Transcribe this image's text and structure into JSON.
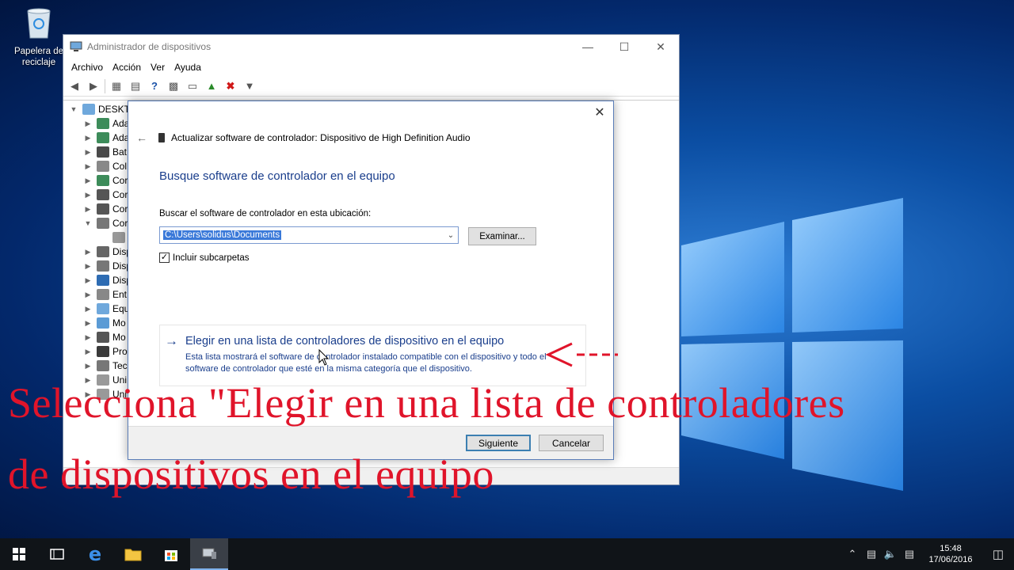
{
  "desktop": {
    "recycle_bin_label": "Papelera de reciclaje"
  },
  "device_manager": {
    "title": "Administrador de dispositivos",
    "menu": [
      "Archivo",
      "Acción",
      "Ver",
      "Ayuda"
    ],
    "tree": [
      {
        "label": "DESKTO",
        "expanded": true,
        "level": 0
      },
      {
        "label": "Ada",
        "level": 1
      },
      {
        "label": "Ada",
        "level": 1
      },
      {
        "label": "Bat",
        "level": 1
      },
      {
        "label": "Col",
        "level": 1
      },
      {
        "label": "Cor",
        "level": 1
      },
      {
        "label": "Cor",
        "level": 1
      },
      {
        "label": "Cor",
        "level": 1
      },
      {
        "label": "Cor",
        "level": 1,
        "expanded": true
      },
      {
        "label": "",
        "level": 2
      },
      {
        "label": "Disp",
        "level": 1
      },
      {
        "label": "Disp",
        "level": 1
      },
      {
        "label": "Disp",
        "level": 1
      },
      {
        "label": "Ent",
        "level": 1
      },
      {
        "label": "Equ",
        "level": 1
      },
      {
        "label": "Mo",
        "level": 1
      },
      {
        "label": "Mo",
        "level": 1
      },
      {
        "label": "Pro",
        "level": 1
      },
      {
        "label": "Tec",
        "level": 1
      },
      {
        "label": "Uni",
        "level": 1
      },
      {
        "label": "Uni",
        "level": 1
      }
    ]
  },
  "wizard": {
    "header": "Actualizar software de controlador: Dispositivo de High Definition Audio",
    "title": "Busque software de controlador en el equipo",
    "location_label": "Buscar el software de controlador en esta ubicación:",
    "location_value": "C:\\Users\\solidus\\Documents",
    "browse_label": "Examinar...",
    "include_subfolders_label": "Incluir subcarpetas",
    "include_subfolders_checked": true,
    "choice_title": "Elegir en una lista de controladores de dispositivo en el equipo",
    "choice_description": "Esta lista mostrará el software de controlador instalado compatible con el dispositivo y todo el software de controlador que esté en la misma categoría que el dispositivo.",
    "next_label": "Siguiente",
    "cancel_label": "Cancelar"
  },
  "caption": {
    "line1": "Selecciona \"Elegir en una lista de controladores",
    "line2": "de dispositivos en el equipo"
  },
  "taskbar": {
    "time": "15:48",
    "date": "17/06/2016"
  },
  "colors": {
    "caption_red": "#e0142a",
    "link_blue": "#1a3e8c",
    "taskbar_bg": "#101418"
  }
}
